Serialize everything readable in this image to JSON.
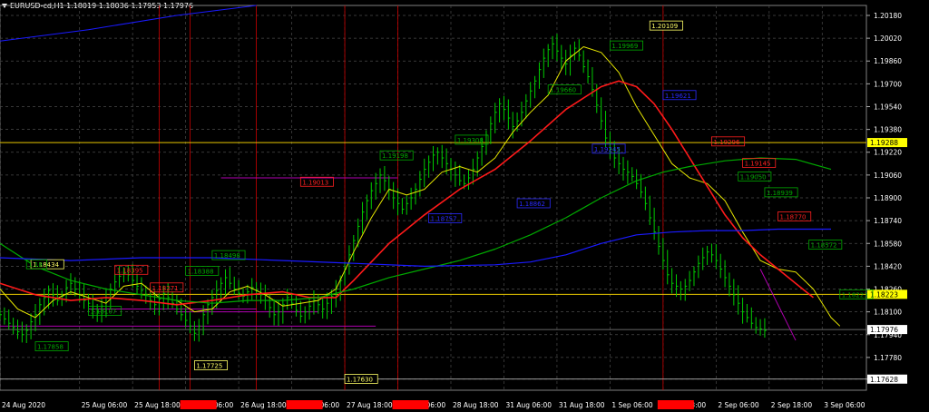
{
  "header": {
    "symbol_line": "EURUSD-cd,H1  1.18019 1.18036 1.17953 1.17976"
  },
  "colors": {
    "background": "#000000",
    "grid": "#4a4a4a",
    "axis_text": "#ffffff",
    "candle": "#00cc00",
    "ma_fast": "#e6e600",
    "ma_mid": "#ff1a1a",
    "ma_slow": "#00aa00",
    "ma_long": "#1a1aff",
    "level": "#e6c700",
    "support": "#b000b0",
    "vline": "#cc0000",
    "label_green": "#00aa00",
    "label_red": "#ff2020",
    "label_blue": "#2a2aff",
    "label_yellow": "#ffff66",
    "current_price_bg": "#ffffff"
  },
  "chart_data": {
    "type": "line",
    "timeframe": "H1",
    "y_ticks": [
      "1.20180",
      "1.20020",
      "1.19860",
      "1.19700",
      "1.19540",
      "1.19380",
      "1.19220",
      "1.19060",
      "1.18900",
      "1.18740",
      "1.18580",
      "1.18420",
      "1.18260",
      "1.18100",
      "1.17940",
      "1.17780",
      "1.17628"
    ],
    "ylim": [
      1.1755,
      1.2025
    ],
    "x_labels": [
      {
        "text": "24 Aug 2020",
        "t": 0
      },
      {
        "text": "25 Aug 06:00",
        "t": 18
      },
      {
        "text": "25 Aug 18:00",
        "t": 30
      },
      {
        "text": "26 Aug 06:00",
        "t": 42
      },
      {
        "text": "26 Aug 18:00",
        "t": 54
      },
      {
        "text": "27 Aug 06:00",
        "t": 66
      },
      {
        "text": "27 Aug 18:00",
        "t": 78
      },
      {
        "text": "28 Aug 06:00",
        "t": 90
      },
      {
        "text": "28 Aug 18:00",
        "t": 102
      },
      {
        "text": "31 Aug 06:00",
        "t": 114
      },
      {
        "text": "31 Aug 18:00",
        "t": 126
      },
      {
        "text": "1 Sep 06:00",
        "t": 138
      },
      {
        "text": "1 Sep 18:00",
        "t": 150
      },
      {
        "text": "2 Sep 06:00",
        "t": 162
      },
      {
        "text": "2 Sep 18:00",
        "t": 174
      },
      {
        "text": "3 Sep 06:00",
        "t": 186
      }
    ],
    "x_highlight_labels": [
      {
        "t": 42,
        "color": "#ff0000"
      },
      {
        "t": 66,
        "color": "#ff0000"
      },
      {
        "t": 90,
        "color": "#ff0000"
      },
      {
        "t": 150,
        "color": "#ff0000"
      }
    ],
    "x_max": 196,
    "candles_close": [
      1.1808,
      1.1805,
      1.1802,
      1.1799,
      1.1796,
      1.1794,
      1.1797,
      1.1803,
      1.1808,
      1.1815,
      1.182,
      1.1825,
      1.1822,
      1.1818,
      1.1821,
      1.1827,
      1.183,
      1.1826,
      1.1822,
      1.1818,
      1.1816,
      1.1812,
      1.181,
      1.1814,
      1.182,
      1.1826,
      1.1831,
      1.1835,
      1.1837,
      1.1836,
      1.1832,
      1.1828,
      1.1825,
      1.1822,
      1.1818,
      1.1815,
      1.1819,
      1.1823,
      1.182,
      1.1816,
      1.1812,
      1.1808,
      1.1804,
      1.18,
      1.1795,
      1.18,
      1.1808,
      1.1815,
      1.182,
      1.1825,
      1.183,
      1.1834,
      1.183,
      1.1826,
      1.1823,
      1.1821,
      1.1824,
      1.1827,
      1.1825,
      1.1822,
      1.1818,
      1.1813,
      1.1808,
      1.181,
      1.1815,
      1.182,
      1.1816,
      1.1811,
      1.1807,
      1.181,
      1.1814,
      1.1818,
      1.1815,
      1.1812,
      1.1816,
      1.1821,
      1.1826,
      1.1832,
      1.184,
      1.185,
      1.186,
      1.187,
      1.188,
      1.1888,
      1.1895,
      1.19,
      1.1906,
      1.1902,
      1.1896,
      1.189,
      1.1886,
      1.1882,
      1.1886,
      1.189,
      1.1896,
      1.1903,
      1.191,
      1.1915,
      1.192,
      1.1922,
      1.1918,
      1.1914,
      1.191,
      1.1906,
      1.1902,
      1.19,
      1.1904,
      1.191,
      1.1918,
      1.1926,
      1.1934,
      1.1942,
      1.195,
      1.1956,
      1.1952,
      1.1946,
      1.194,
      1.1944,
      1.195,
      1.1958,
      1.1965,
      1.1972,
      1.198,
      1.1988,
      1.1994,
      1.1998,
      1.1993,
      1.1988,
      1.1984,
      1.199,
      1.1995,
      1.199,
      1.1982,
      1.1975,
      1.1966,
      1.1955,
      1.1944,
      1.1932,
      1.1924,
      1.1918,
      1.1914,
      1.191,
      1.1908,
      1.1905,
      1.19,
      1.1894,
      1.1886,
      1.1876,
      1.1866,
      1.1856,
      1.1846,
      1.1836,
      1.183,
      1.1828,
      1.1826,
      1.1828,
      1.1832,
      1.1838,
      1.1844,
      1.1848,
      1.1852,
      1.185,
      1.1846,
      1.184,
      1.1834,
      1.1828,
      1.1822,
      1.1816,
      1.181,
      1.1806,
      1.1802,
      1.1799,
      1.1798,
      1.1797
    ],
    "series": [
      {
        "key": "ma_fast",
        "color": "#e6e600",
        "width": 1,
        "points": [
          [
            0,
            1.1826
          ],
          [
            4,
            1.1812
          ],
          [
            8,
            1.1806
          ],
          [
            12,
            1.1818
          ],
          [
            16,
            1.1824
          ],
          [
            20,
            1.182
          ],
          [
            24,
            1.1816
          ],
          [
            28,
            1.1828
          ],
          [
            32,
            1.183
          ],
          [
            36,
            1.182
          ],
          [
            40,
            1.1818
          ],
          [
            44,
            1.181
          ],
          [
            48,
            1.1812
          ],
          [
            52,
            1.1824
          ],
          [
            56,
            1.1828
          ],
          [
            60,
            1.1822
          ],
          [
            64,
            1.1814
          ],
          [
            68,
            1.1816
          ],
          [
            72,
            1.1818
          ],
          [
            76,
            1.1826
          ],
          [
            80,
            1.1852
          ],
          [
            84,
            1.1876
          ],
          [
            88,
            1.1896
          ],
          [
            92,
            1.1892
          ],
          [
            96,
            1.1896
          ],
          [
            100,
            1.1908
          ],
          [
            104,
            1.1912
          ],
          [
            108,
            1.1908
          ],
          [
            112,
            1.1918
          ],
          [
            116,
            1.1936
          ],
          [
            120,
            1.195
          ],
          [
            124,
            1.1962
          ],
          [
            128,
            1.1986
          ],
          [
            132,
            1.1996
          ],
          [
            136,
            1.1992
          ],
          [
            140,
            1.1978
          ],
          [
            144,
            1.1954
          ],
          [
            148,
            1.1934
          ],
          [
            152,
            1.1914
          ],
          [
            156,
            1.1904
          ],
          [
            160,
            1.19
          ],
          [
            164,
            1.1888
          ],
          [
            168,
            1.1866
          ],
          [
            172,
            1.1846
          ],
          [
            176,
            1.184
          ],
          [
            180,
            1.1838
          ],
          [
            184,
            1.1826
          ],
          [
            188,
            1.1806
          ],
          [
            190,
            1.18
          ]
        ]
      },
      {
        "key": "ma_mid",
        "color": "#ff1a1a",
        "width": 1.6,
        "points": [
          [
            0,
            1.183
          ],
          [
            8,
            1.1822
          ],
          [
            16,
            1.1818
          ],
          [
            24,
            1.182
          ],
          [
            32,
            1.1818
          ],
          [
            40,
            1.1815
          ],
          [
            48,
            1.1818
          ],
          [
            56,
            1.1822
          ],
          [
            64,
            1.1824
          ],
          [
            70,
            1.182
          ],
          [
            76,
            1.182
          ],
          [
            80,
            1.1832
          ],
          [
            88,
            1.1858
          ],
          [
            96,
            1.1878
          ],
          [
            104,
            1.1896
          ],
          [
            112,
            1.191
          ],
          [
            120,
            1.193
          ],
          [
            128,
            1.1952
          ],
          [
            136,
            1.1968
          ],
          [
            140,
            1.1972
          ],
          [
            144,
            1.1968
          ],
          [
            148,
            1.1956
          ],
          [
            152,
            1.1938
          ],
          [
            156,
            1.1918
          ],
          [
            160,
            1.1898
          ],
          [
            164,
            1.1878
          ],
          [
            168,
            1.1862
          ],
          [
            172,
            1.185
          ],
          [
            176,
            1.184
          ],
          [
            180,
            1.183
          ],
          [
            184,
            1.182
          ]
        ]
      },
      {
        "key": "ma_slow",
        "color": "#00aa00",
        "width": 1.2,
        "points": [
          [
            0,
            1.1858
          ],
          [
            8,
            1.1842
          ],
          [
            16,
            1.1832
          ],
          [
            24,
            1.1826
          ],
          [
            32,
            1.1822
          ],
          [
            40,
            1.1818
          ],
          [
            48,
            1.1816
          ],
          [
            56,
            1.1818
          ],
          [
            64,
            1.1818
          ],
          [
            72,
            1.182
          ],
          [
            80,
            1.1826
          ],
          [
            88,
            1.1834
          ],
          [
            96,
            1.184
          ],
          [
            104,
            1.1846
          ],
          [
            112,
            1.1854
          ],
          [
            120,
            1.1864
          ],
          [
            128,
            1.1876
          ],
          [
            136,
            1.189
          ],
          [
            144,
            1.1902
          ],
          [
            150,
            1.1908
          ],
          [
            156,
            1.1912
          ],
          [
            164,
            1.1916
          ],
          [
            172,
            1.1918
          ],
          [
            180,
            1.1917
          ],
          [
            188,
            1.191
          ]
        ]
      },
      {
        "key": "ma_long",
        "color": "#1a1aff",
        "width": 1.2,
        "points": [
          [
            0,
            1.1848
          ],
          [
            16,
            1.1846
          ],
          [
            32,
            1.1848
          ],
          [
            48,
            1.1848
          ],
          [
            64,
            1.1846
          ],
          [
            80,
            1.1844
          ],
          [
            96,
            1.1842
          ],
          [
            112,
            1.1843
          ],
          [
            120,
            1.1845
          ],
          [
            128,
            1.185
          ],
          [
            136,
            1.1858
          ],
          [
            144,
            1.1864
          ],
          [
            152,
            1.1866
          ],
          [
            160,
            1.1867
          ],
          [
            168,
            1.1867
          ],
          [
            176,
            1.1868
          ],
          [
            188,
            1.1868
          ]
        ]
      },
      {
        "key": "early_blue",
        "color": "#1a1aff",
        "width": 1,
        "points": [
          [
            0,
            1.2
          ],
          [
            20,
            1.2008
          ],
          [
            40,
            1.2018
          ],
          [
            58,
            1.2025
          ]
        ]
      }
    ],
    "h_levels": [
      {
        "price": 1.19288,
        "color": "#e6c700",
        "label": "1.19288"
      },
      {
        "price": 1.18223,
        "color": "#e6c700",
        "label": "1.18223"
      }
    ],
    "current_price": {
      "price": 1.17976,
      "label": "1.17976"
    },
    "bottom_price": {
      "price": 1.17628,
      "label": "1.17628"
    },
    "support_segments": [
      {
        "t0": 0,
        "t1": 85,
        "price": 1.18,
        "color": "#b000b0"
      },
      {
        "t0": 20,
        "t1": 58,
        "price": 1.1812,
        "color": "#b000b0"
      },
      {
        "t0": 40,
        "t1": 72,
        "price": 1.181,
        "color": "#b000b0"
      },
      {
        "t0": 50,
        "t1": 90,
        "price": 1.1904,
        "color": "#b000b0"
      },
      {
        "t0": 172,
        "t1": 180,
        "price": 1.179,
        "color": "#b000b0",
        "diag_to": 1.184
      }
    ],
    "v_lines": [
      36,
      43,
      58,
      78,
      90,
      150
    ],
    "price_labels": [
      {
        "t": 7,
        "price": 1.18434,
        "text": "1.18434",
        "style": "yellow"
      },
      {
        "t": 6,
        "price": 1.18434,
        "text": "1.18",
        "style": "green"
      },
      {
        "t": 20,
        "price": 1.18107,
        "text": "1.18107",
        "style": "green"
      },
      {
        "t": 8,
        "price": 1.17858,
        "text": "1.17858",
        "style": "green"
      },
      {
        "t": 26,
        "price": 1.18395,
        "text": "1.18395",
        "style": "red"
      },
      {
        "t": 34,
        "price": 1.18271,
        "text": "1.18271",
        "style": "red"
      },
      {
        "t": 42,
        "price": 1.18388,
        "text": "1.18388",
        "style": "green"
      },
      {
        "t": 48,
        "price": 1.18498,
        "text": "1.18498",
        "style": "green"
      },
      {
        "t": 44,
        "price": 1.17725,
        "text": "1.17725",
        "style": "yellow"
      },
      {
        "t": 68,
        "price": 1.19013,
        "text": "1.19013",
        "style": "red"
      },
      {
        "t": 78,
        "price": 1.1763,
        "text": "1.17630",
        "style": "yellow"
      },
      {
        "t": 86,
        "price": 1.19198,
        "text": "1.19198",
        "style": "green"
      },
      {
        "t": 103,
        "price": 1.19308,
        "text": "1.19308",
        "style": "green"
      },
      {
        "t": 97,
        "price": 1.18757,
        "text": "1.18757",
        "style": "blue"
      },
      {
        "t": 117,
        "price": 1.18862,
        "text": "1.18862",
        "style": "blue"
      },
      {
        "t": 124,
        "price": 1.1966,
        "text": "1.19660",
        "style": "green"
      },
      {
        "t": 134,
        "price": 1.19245,
        "text": "1.19245",
        "style": "blue"
      },
      {
        "t": 138,
        "price": 1.19969,
        "text": "1.19969",
        "style": "green"
      },
      {
        "t": 147,
        "price": 1.20109,
        "text": "1.20109",
        "style": "yellow"
      },
      {
        "t": 150,
        "price": 1.19621,
        "text": "1.19621",
        "style": "blue"
      },
      {
        "t": 161,
        "price": 1.19296,
        "text": "1.19296",
        "style": "red"
      },
      {
        "t": 168,
        "price": 1.19145,
        "text": "1.19145",
        "style": "red"
      },
      {
        "t": 167,
        "price": 1.1905,
        "text": "1.19050",
        "style": "green"
      },
      {
        "t": 173,
        "price": 1.18939,
        "text": "1.18939",
        "style": "green"
      },
      {
        "t": 176,
        "price": 1.1877,
        "text": "1.18770",
        "style": "red"
      },
      {
        "t": 183,
        "price": 1.18572,
        "text": "1.18572",
        "style": "green"
      },
      {
        "t": 190,
        "price": 1.18223,
        "text": "1.18223",
        "style": "green"
      }
    ]
  }
}
